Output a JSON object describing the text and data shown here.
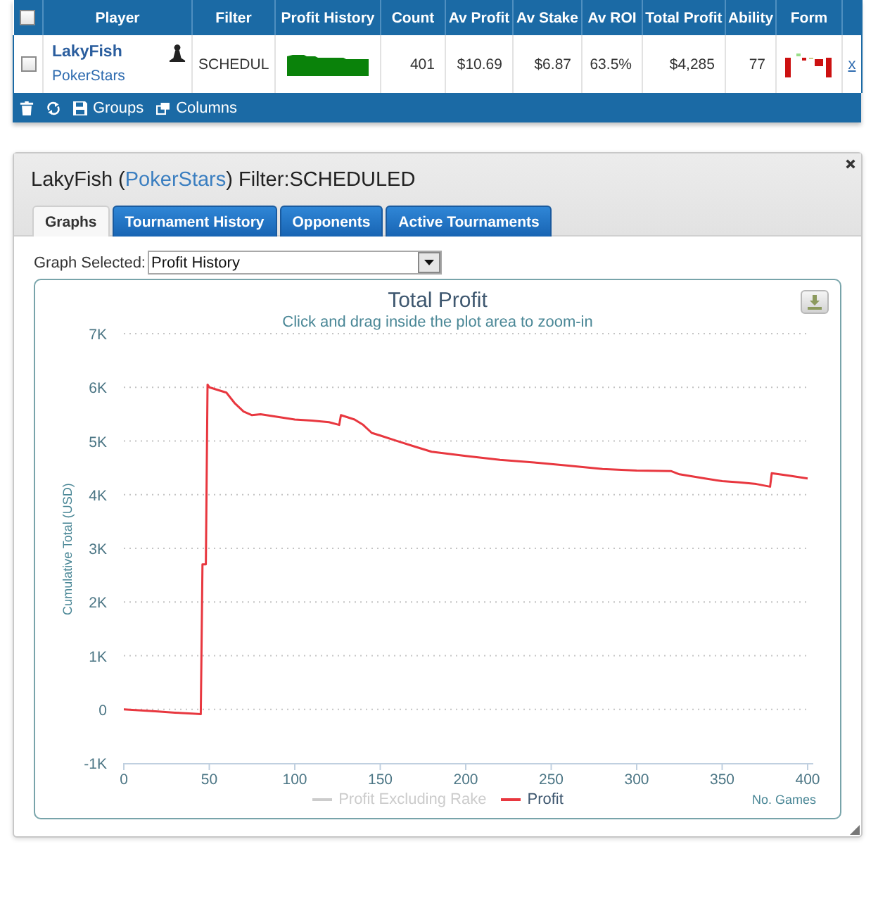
{
  "table": {
    "select_all": {
      "checked": false
    },
    "columns": [
      "Player",
      "Filter",
      "Profit History",
      "Count",
      "Av Profit",
      "Av Stake",
      "Av ROI",
      "Total Profit",
      "Ability",
      "Form"
    ],
    "rows": [
      {
        "checked": false,
        "player": "LakyFish",
        "site": "PokerStars",
        "filter": "SCHEDUL",
        "count": "401",
        "av_profit": "$10.69",
        "av_stake": "$6.87",
        "av_roi": "63.5%",
        "total_profit": "$4,285",
        "ability": "77",
        "remove": "x"
      }
    ],
    "toolbar": [
      {
        "kind": "delete"
      },
      {
        "kind": "refresh"
      },
      {
        "kind": "groups",
        "label": "Groups"
      },
      {
        "kind": "columns",
        "label": "Columns"
      }
    ]
  },
  "panel": {
    "title": {
      "before": "LakyFish (",
      "link": "PokerStars",
      "after": ") Filter:SCHEDULED"
    },
    "tabs": [
      {
        "label": "Graphs",
        "selected": true
      },
      {
        "label": "Tournament History",
        "selected": false
      },
      {
        "label": "Opponents",
        "selected": false
      },
      {
        "label": "Active Tournaments",
        "selected": false
      }
    ],
    "graph_select": {
      "label": "Graph Selected:",
      "value": "Profit History"
    },
    "chart": {
      "subtitle": "Click and drag inside the plot area to zoom-in",
      "chart_data": {
        "type": "line",
        "title": "Total Profit",
        "xlabel": "No. Games",
        "ylabel": "Cumulative Total (USD)",
        "grid": true,
        "xlim": [
          0,
          400
        ],
        "ylim": [
          -1000,
          7000
        ],
        "xticks": [
          0,
          50,
          100,
          150,
          200,
          250,
          300,
          350,
          400
        ],
        "yticks": [
          {
            "value": -1000,
            "label": "-1K"
          },
          {
            "value": 0,
            "label": "0"
          },
          {
            "value": 1000,
            "label": "1K"
          },
          {
            "value": 2000,
            "label": "2K"
          },
          {
            "value": 3000,
            "label": "3K"
          },
          {
            "value": 4000,
            "label": "4K"
          },
          {
            "value": 5000,
            "label": "5K"
          },
          {
            "value": 6000,
            "label": "6K"
          },
          {
            "value": 7000,
            "label": "7K"
          }
        ],
        "x": [
          0,
          10,
          20,
          30,
          40,
          45,
          46,
          48,
          49,
          50,
          55,
          60,
          65,
          70,
          75,
          80,
          90,
          100,
          110,
          120,
          126,
          127,
          135,
          140,
          145,
          150,
          160,
          170,
          180,
          190,
          200,
          220,
          240,
          260,
          280,
          300,
          320,
          325,
          340,
          350,
          360,
          370,
          378,
          379,
          390,
          400
        ],
        "series": [
          {
            "name": "Profit Excluding Rake",
            "color": "#cccccc",
            "values": [
              null,
              null,
              null,
              null,
              null,
              null,
              null,
              null,
              null,
              null,
              null,
              null,
              null,
              null,
              null,
              null,
              null,
              null,
              null,
              null,
              null,
              null,
              null,
              null,
              null,
              null,
              null,
              null,
              null,
              null,
              null,
              null,
              null,
              null,
              null,
              null,
              null,
              null,
              null,
              null,
              null,
              null,
              null,
              null,
              null,
              null
            ]
          },
          {
            "name": "Profit",
            "color": "#e8373f",
            "values": [
              0,
              -20,
              -40,
              -60,
              -80,
              -90,
              2700,
              2700,
              6050,
              6000,
              5950,
              5900,
              5700,
              5550,
              5480,
              5500,
              5450,
              5400,
              5380,
              5350,
              5300,
              5480,
              5400,
              5300,
              5150,
              5100,
              5000,
              4900,
              4800,
              4760,
              4720,
              4650,
              4600,
              4540,
              4480,
              4450,
              4440,
              4380,
              4300,
              4250,
              4230,
              4200,
              4150,
              4400,
              4350,
              4300
            ]
          }
        ]
      }
    }
  }
}
